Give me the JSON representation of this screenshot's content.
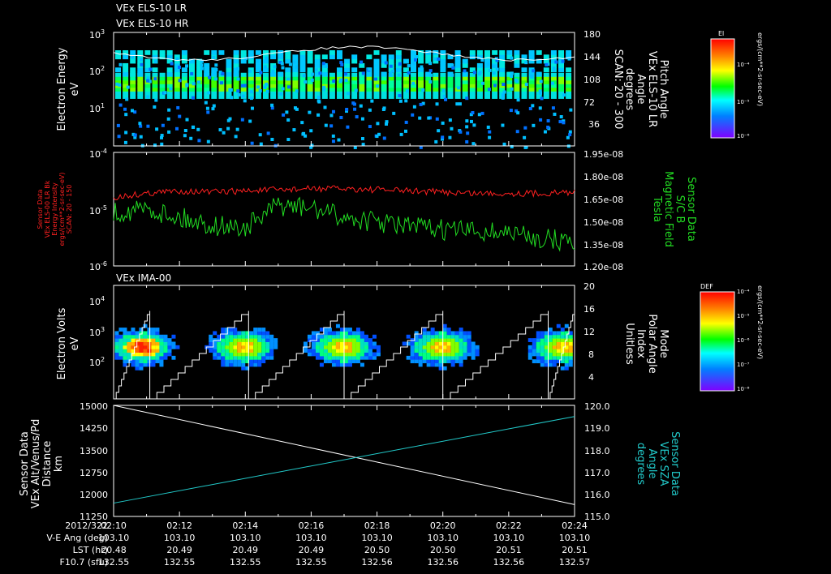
{
  "colors": {
    "background": "#000000",
    "axis": "#ffffff",
    "trace_red": "#ff2020",
    "trace_green": "#22dd22",
    "trace_cyan": "#22cccc",
    "trace_white": "#ffffff"
  },
  "panel1": {
    "header1": "VEx ELS-10 LR",
    "header2": "VEx ELS-10 HR",
    "ylabel1": "Electron Energy",
    "ylabel2": "eV",
    "yticks": [
      {
        "base": "10",
        "exp": "3"
      },
      {
        "base": "10",
        "exp": "2"
      },
      {
        "base": "10",
        "exp": "1"
      }
    ],
    "right_ticks": [
      "180",
      "144",
      "108",
      "72",
      "36"
    ],
    "right_label": [
      "Pitch Angle",
      "VEx ELS-10 LR",
      "Angle",
      "degrees",
      "SCAN: 20 - 300"
    ],
    "colorbar": {
      "title": "El",
      "ticks": [
        "10⁻⁴",
        "10⁻⁵",
        "10⁻⁶"
      ],
      "unit": "ergs/(cm**2-sr-sec-eV)"
    }
  },
  "panel2": {
    "left_label": [
      "Sensor Data",
      "VEx ELS-00 LR Bk",
      "Energy Intensity",
      "ergs/(cm**2-sr-sec-eV)",
      "SCAN: 20 - 150"
    ],
    "yticks": [
      {
        "base": "10",
        "exp": "-4"
      },
      {
        "base": "10",
        "exp": "-5"
      },
      {
        "base": "10",
        "exp": "-6"
      }
    ],
    "right_ticks": [
      "1.95e-08",
      "1.80e-08",
      "1.65e-08",
      "1.50e-08",
      "1.35e-08",
      "1.20e-08"
    ],
    "right_label": [
      "Sensor Data",
      "S/C B",
      "Magnetic Field",
      "Tesla"
    ]
  },
  "panel3": {
    "header": "VEx IMA-00",
    "ylabel1": "Electron Volts",
    "ylabel2": "eV",
    "yticks": [
      {
        "base": "10",
        "exp": "4"
      },
      {
        "base": "10",
        "exp": "3"
      },
      {
        "base": "10",
        "exp": "2"
      }
    ],
    "right_ticks": [
      "20",
      "16",
      "12",
      "8",
      "4"
    ],
    "right_label": [
      "Mode",
      "Polar Angle",
      "Index",
      "Unitless"
    ],
    "colorbar": {
      "title": "DEF",
      "ticks": [
        "10⁻⁴",
        "10⁻⁵",
        "10⁻⁶",
        "10⁻⁷",
        "10⁻⁸"
      ],
      "unit": "ergs/(cm**2-sr-sec-eV)"
    }
  },
  "panel4": {
    "left_label": [
      "Sensor Data",
      "VEx Alt/Venus/Pd",
      "Distance",
      "km"
    ],
    "left_ticks": [
      "15000",
      "14250",
      "13500",
      "12750",
      "12000",
      "11250"
    ],
    "right_ticks": [
      "120.0",
      "119.0",
      "118.0",
      "117.0",
      "116.0",
      "115.0"
    ],
    "right_label": [
      "Sensor Data",
      "VEx SZA",
      "Angle",
      "degrees"
    ]
  },
  "footer": {
    "row_labels": [
      "2012/322",
      "V-E Ang (deg)",
      "LST (hr)",
      "F10.7 (sfu)"
    ],
    "times": [
      "02:10",
      "02:12",
      "02:14",
      "02:16",
      "02:18",
      "02:20",
      "02:22",
      "02:24"
    ],
    "ve_ang": [
      "103.10",
      "103.10",
      "103.10",
      "103.10",
      "103.10",
      "103.10",
      "103.10",
      "103.10"
    ],
    "lst": [
      "20.48",
      "20.49",
      "20.49",
      "20.49",
      "20.50",
      "20.50",
      "20.51",
      "20.51"
    ],
    "f107": [
      "132.55",
      "132.55",
      "132.55",
      "132.55",
      "132.56",
      "132.56",
      "132.56",
      "132.57"
    ]
  },
  "chart_data": [
    {
      "type": "heatmap",
      "title": "VEx ELS-10 LR / VEx ELS-10 HR",
      "ylabel": "Electron Energy eV",
      "yscale": "log",
      "ylim": [
        1,
        1000
      ],
      "x_range": [
        "02:10",
        "02:24"
      ],
      "y2label": "Pitch Angle VEx ELS-10 LR Angle degrees SCAN: 20 - 300",
      "y2lim": [
        0,
        180
      ],
      "description_band": "intense band near 20-60 eV, scattered pixels elsewhere",
      "overlay_line_y2": 140
    },
    {
      "type": "line",
      "ylabel": "Sensor Data VEx ELS-00 LR Bk Energy Intensity",
      "yscale": "log",
      "ylim": [
        1e-06,
        0.0001
      ],
      "y2label": "Sensor Data S/C B Magnetic Field Tesla",
      "y2lim": [
        1.2e-08,
        1.95e-08
      ],
      "x_range": [
        "02:10",
        "02:24"
      ],
      "series": [
        {
          "name": "Energy Intensity",
          "axis": "left",
          "color": "#ff2020",
          "x": [
            "02:10",
            "02:11",
            "02:12",
            "02:13",
            "02:14",
            "02:15",
            "02:16",
            "02:17",
            "02:18",
            "02:19",
            "02:20",
            "02:21",
            "02:22",
            "02:23",
            "02:24"
          ],
          "values": [
            1.6e-05,
            1.9e-05,
            2.1e-05,
            2e-05,
            2.1e-05,
            2.2e-05,
            2.3e-05,
            2.3e-05,
            2.2e-05,
            2.1e-05,
            2e-05,
            1.9e-05,
            1.9e-05,
            1.9e-05,
            2e-05
          ]
        },
        {
          "name": "Magnetic Field",
          "axis": "right",
          "color": "#22dd22",
          "x": [
            "02:10",
            "02:11",
            "02:12",
            "02:13",
            "02:14",
            "02:15",
            "02:16",
            "02:17",
            "02:18",
            "02:19",
            "02:20",
            "02:21",
            "02:22",
            "02:23",
            "02:24"
          ],
          "values": [
            1.55e-08,
            1.58e-08,
            1.52e-08,
            1.47e-08,
            1.45e-08,
            1.6e-08,
            1.58e-08,
            1.52e-08,
            1.49e-08,
            1.46e-08,
            1.44e-08,
            1.43e-08,
            1.42e-08,
            1.38e-08,
            1.36e-08
          ]
        }
      ]
    },
    {
      "type": "heatmap",
      "title": "VEx IMA-00",
      "ylabel": "Electron Volts eV",
      "yscale": "log",
      "ylim": [
        30,
        50000
      ],
      "y2label": "Mode Polar Angle Index Unitless",
      "y2lim": [
        0,
        20
      ],
      "x_range": [
        "02:10",
        "02:24"
      ],
      "bursts_center_times": [
        "02:10.8",
        "02:13.9",
        "02:16.9",
        "02:19.9",
        "02:23.5"
      ],
      "burst_peak_energy_ev": 800
    },
    {
      "type": "line",
      "ylabel": "Sensor Data VEx Alt/Venus/Pd Distance km",
      "ylim": [
        11250,
        15000
      ],
      "y2label": "Sensor Data VEx SZA Angle degrees",
      "y2lim": [
        115.0,
        120.0
      ],
      "x": [
        "02:10",
        "02:24"
      ],
      "series": [
        {
          "name": "Distance",
          "axis": "left",
          "color": "#ffffff",
          "values": [
            15000,
            11650
          ]
        },
        {
          "name": "SZA",
          "axis": "right",
          "color": "#22cccc",
          "values": [
            115.6,
            119.5
          ]
        }
      ]
    }
  ]
}
